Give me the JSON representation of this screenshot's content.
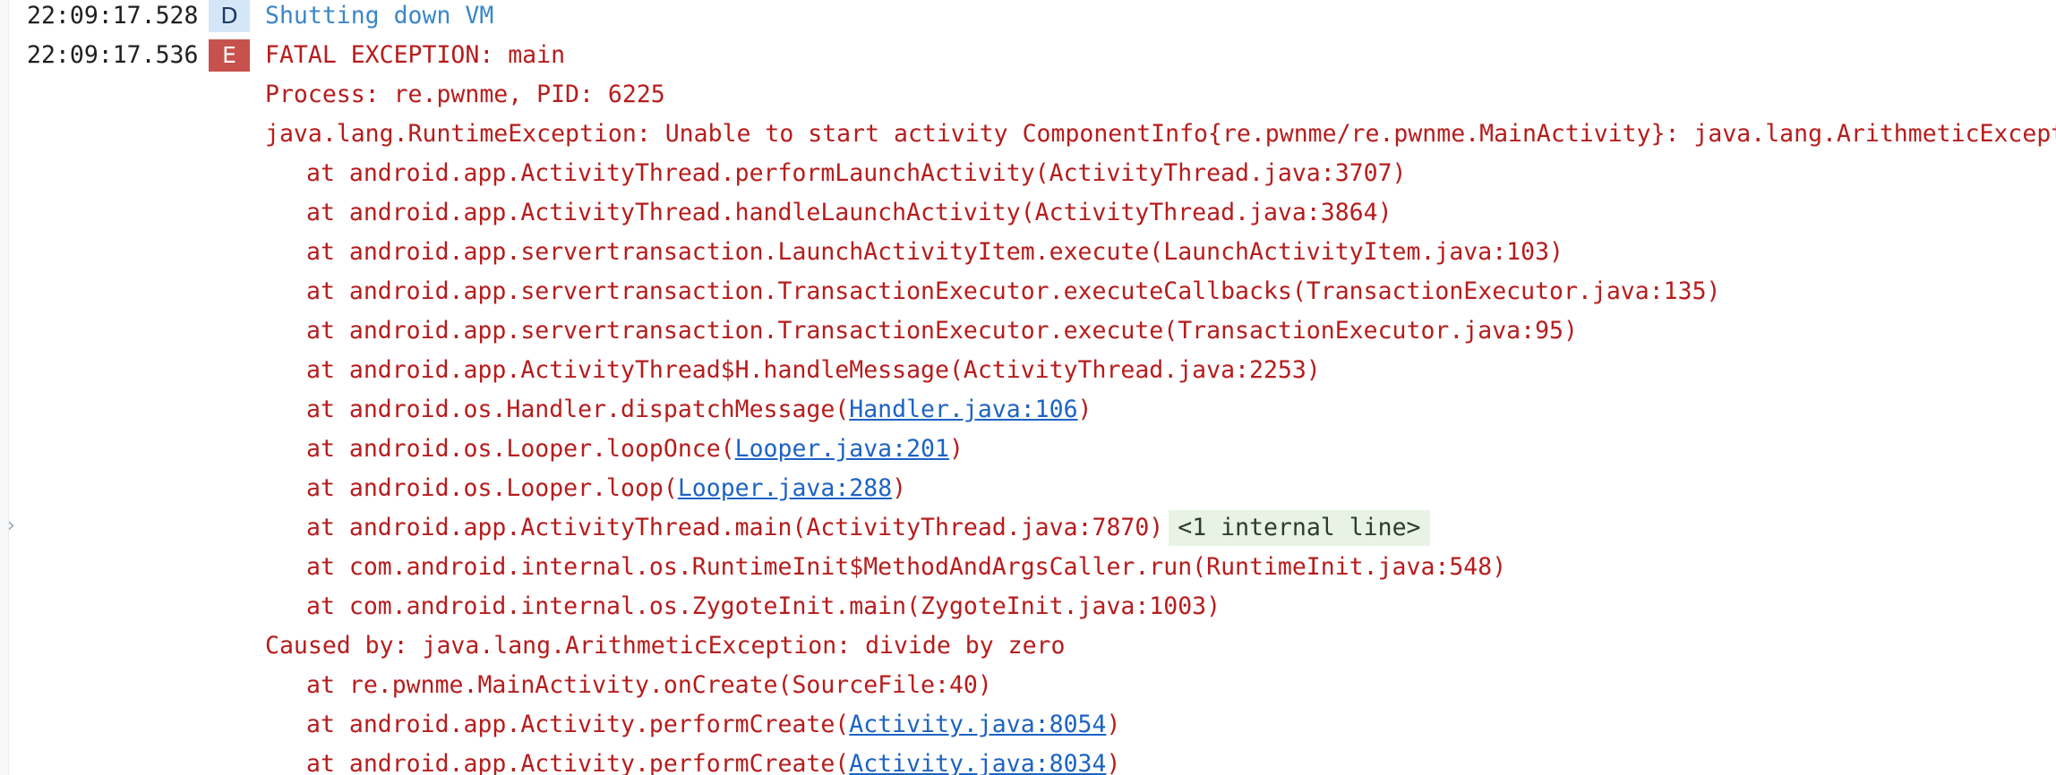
{
  "log": {
    "entry1": {
      "timestamp": "22:09:17.528",
      "level": "D",
      "message": "Shutting down VM"
    },
    "entry2": {
      "timestamp": "22:09:17.536",
      "level": "E",
      "message": "FATAL EXCEPTION: main",
      "process": "Process: re.pwnme, PID: 6225",
      "exception": "java.lang.RuntimeException: Unable to start activity ComponentInfo{re.pwnme/re.pwnme.MainActivity}: java.lang.ArithmeticException",
      "frames": [
        "at android.app.ActivityThread.performLaunchActivity(ActivityThread.java:3707)",
        "at android.app.ActivityThread.handleLaunchActivity(ActivityThread.java:3864)",
        "at android.app.servertransaction.LaunchActivityItem.execute(LaunchActivityItem.java:103)",
        "at android.app.servertransaction.TransactionExecutor.executeCallbacks(TransactionExecutor.java:135)",
        "at android.app.servertransaction.TransactionExecutor.execute(TransactionExecutor.java:95)",
        "at android.app.ActivityThread$H.handleMessage(ActivityThread.java:2253)"
      ],
      "linked_frames": [
        {
          "prefix": "at android.os.Handler.dispatchMessage(",
          "link": "Handler.java:106",
          "suffix": ")"
        },
        {
          "prefix": "at android.os.Looper.loopOnce(",
          "link": "Looper.java:201",
          "suffix": ")"
        },
        {
          "prefix": "at android.os.Looper.loop(",
          "link": "Looper.java:288",
          "suffix": ")"
        }
      ],
      "main_frame": "at android.app.ActivityThread.main(ActivityThread.java:7870)",
      "internal_lines": "<1 internal line>",
      "frames_after": [
        "at com.android.internal.os.RuntimeInit$MethodAndArgsCaller.run(RuntimeInit.java:548)",
        "at com.android.internal.os.ZygoteInit.main(ZygoteInit.java:1003)"
      ],
      "caused_by": "Caused by: java.lang.ArithmeticException: divide by zero",
      "cause_frame": "at re.pwnme.MainActivity.onCreate(SourceFile:40)",
      "cause_linked_frames": [
        {
          "prefix": "at android.app.Activity.performCreate(",
          "link": "Activity.java:8054",
          "suffix": ")"
        },
        {
          "prefix": "at android.app.Activity.performCreate(",
          "link": "Activity.java:8034",
          "suffix": ")"
        }
      ]
    }
  },
  "gutter": {
    "fold_icon": "chevron-right-icon"
  },
  "colors": {
    "debug_text": "#3b86c9",
    "error_text": "#b71c1c",
    "link": "#1d63c4",
    "error_badge": "#c7524d",
    "debug_badge": "#d6e6f9",
    "internal_chip": "#e8f3e5"
  }
}
